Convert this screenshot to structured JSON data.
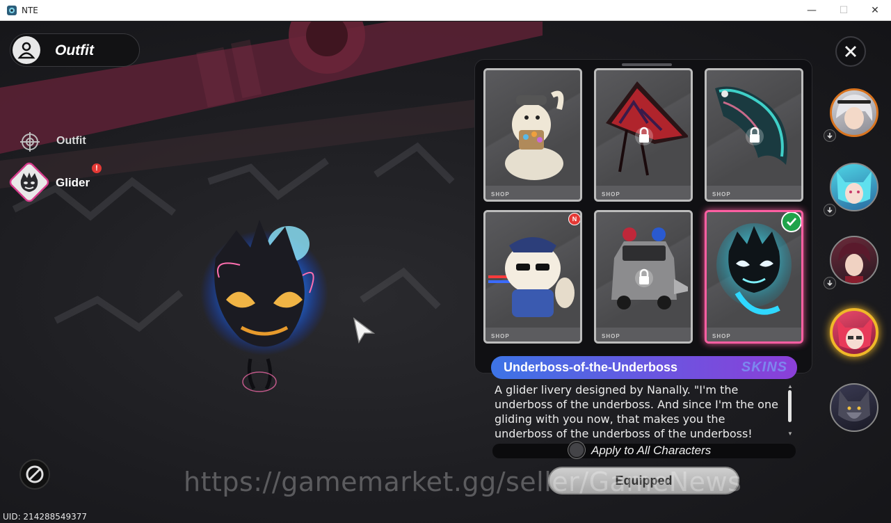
{
  "window": {
    "title": "NTE",
    "minimize": "—",
    "maximize": "☐",
    "close": "✕"
  },
  "header": {
    "title": "Outfit",
    "icon": "person-icon"
  },
  "nav": [
    {
      "label": "Outfit",
      "icon": "target-icon"
    },
    {
      "label": "Glider",
      "icon": "glider-face-icon",
      "alert": "!"
    }
  ],
  "uid": "UID: 214288549377",
  "skins": [
    {
      "name": "fox-doll-glider",
      "locked": false
    },
    {
      "name": "red-kite-glider",
      "locked": true
    },
    {
      "name": "koi-windsock-glider",
      "locked": true
    },
    {
      "name": "hamster-police-glider",
      "locked": false,
      "badge": "N"
    },
    {
      "name": "police-car-glider",
      "locked": true
    },
    {
      "name": "blue-flame-spirit-glider",
      "locked": false,
      "equipped": true
    }
  ],
  "card_footer": "SHOP",
  "selected": {
    "name": "Underboss-of-the-Underboss",
    "tag": "SKINS",
    "description": "A glider livery designed by Nanally. \"I'm the underboss of the underboss. And since I'm the one gliding with you now, that makes you the underboss of the underboss of the underboss!"
  },
  "apply_all": "Apply to All Characters",
  "equip_button": "Equipped",
  "watermark": "https://gamemarket.gg/seller/GameNews",
  "characters": [
    {
      "name": "silver-hair-character",
      "ring": "#d9741f"
    },
    {
      "name": "cyan-hair-character",
      "ring": "#888"
    },
    {
      "name": "maroon-hair-character",
      "ring": "#888"
    },
    {
      "name": "red-hair-character",
      "ring": "#f0b829",
      "active": true
    },
    {
      "name": "wolf-character",
      "ring": "#888"
    }
  ],
  "colors": {
    "accent_pink": "#d63c8c",
    "equipped_green": "#1fa34a",
    "name_bar_start": "#3d74e6",
    "name_bar_end": "#8b3fd8"
  }
}
